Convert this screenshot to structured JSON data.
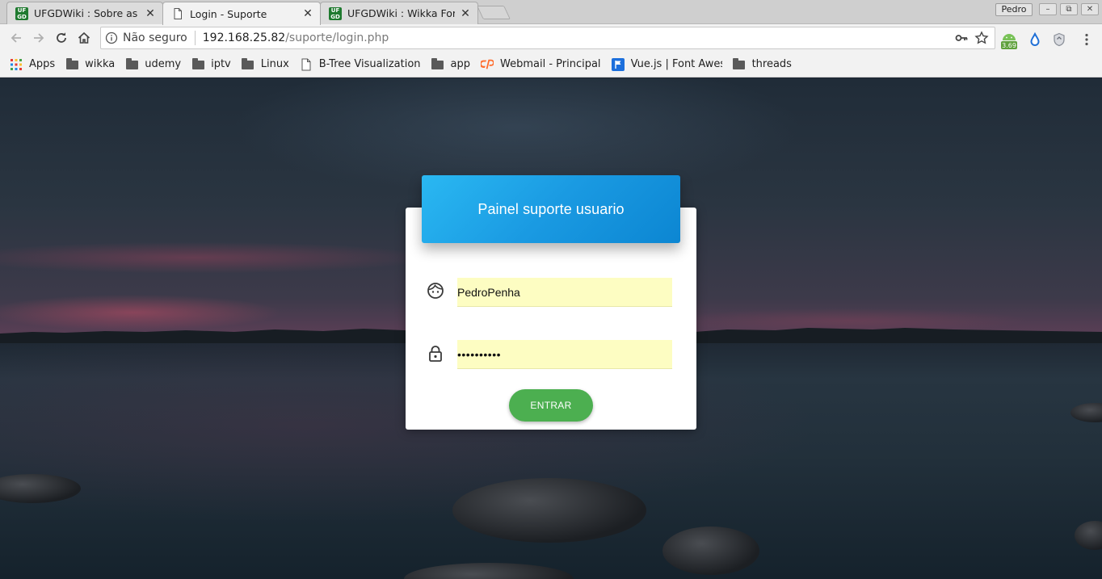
{
  "browser": {
    "tabs": [
      {
        "title": "UFGDWiki : Sobre as pá",
        "favicon": "ufgd-favicon",
        "active": false
      },
      {
        "title": "Login - Suporte",
        "favicon": "page-favicon",
        "active": true
      },
      {
        "title": "UFGDWiki : Wikka Forma",
        "favicon": "ufgd-favicon",
        "active": false
      }
    ],
    "favicon_text": {
      "top": "UF",
      "bottom": "GD"
    },
    "close_glyph": "✕",
    "profile_name": "Pedro",
    "window_controls": {
      "minimize": "–",
      "restore": "⧉",
      "close": "✕"
    },
    "address": {
      "security_label": "Não seguro",
      "host": "192.168.25.82",
      "path": "/suporte/login.php"
    },
    "extension_badge": "3.69",
    "bookmarks": [
      {
        "label": "Apps",
        "icon": "apps-grid-icon"
      },
      {
        "label": "wikka",
        "icon": "folder-icon"
      },
      {
        "label": "udemy",
        "icon": "folder-icon"
      },
      {
        "label": "iptv",
        "icon": "folder-icon"
      },
      {
        "label": "Linux",
        "icon": "folder-icon"
      },
      {
        "label": "B-Tree Visualization",
        "icon": "page-icon"
      },
      {
        "label": "app",
        "icon": "folder-icon"
      },
      {
        "label": "Webmail - Principal",
        "icon": "cpanel-icon"
      },
      {
        "label": "Vue.js | Font Aweso",
        "icon": "flag-icon"
      },
      {
        "label": "threads",
        "icon": "folder-icon"
      }
    ]
  },
  "login": {
    "header_title": "Painel suporte usuario",
    "username_value": "PedroPenha",
    "password_mask": "••••••••••",
    "submit_label": "ENTRAR",
    "colors": {
      "header": "#1a9ae2",
      "button": "#4caf50",
      "autofill": "#fdfdc2"
    }
  }
}
